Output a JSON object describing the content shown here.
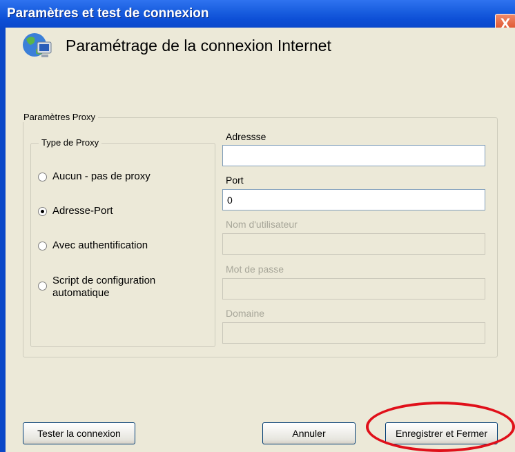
{
  "window": {
    "title": "Paramètres et test de connexion",
    "close_glyph": "X"
  },
  "header": {
    "title": "Paramétrage de la connexion Internet",
    "icon": "network-globe-computer-icon"
  },
  "proxy_group": {
    "legend": "Paramètres Proxy"
  },
  "proxy_type": {
    "legend": "Type de Proxy",
    "options": [
      {
        "label": "Aucun - pas de proxy",
        "checked": false
      },
      {
        "label": "Adresse-Port",
        "checked": true
      },
      {
        "label": "Avec authentification",
        "checked": false
      },
      {
        "label": "Script de configuration automatique",
        "checked": false
      }
    ]
  },
  "fields": {
    "address": {
      "label": "Adressse",
      "value": ""
    },
    "port": {
      "label": "Port",
      "value": "0"
    },
    "username": {
      "label": "Nom d'utilisateur",
      "value": ""
    },
    "password": {
      "label": "Mot de passe",
      "value": ""
    },
    "domain": {
      "label": "Domaine",
      "value": ""
    }
  },
  "buttons": {
    "test": "Tester la connexion",
    "cancel": "Annuler",
    "save": "Enregistrer et Fermer"
  },
  "colors": {
    "titlebar": "#0a48cc",
    "client_bg": "#ece9d8",
    "highlight": "#e0101a"
  }
}
